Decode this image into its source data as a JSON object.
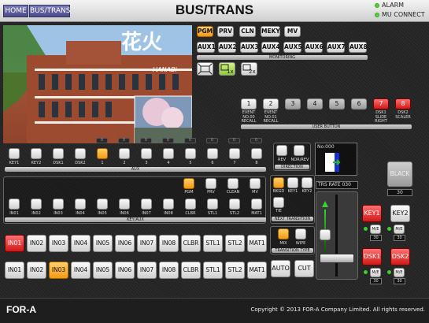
{
  "header": {
    "home_label": "HOME",
    "crumb_label": "BUS/TRANS",
    "title": "BUS/TRANS",
    "alarm": "ALARM",
    "mu_connect": "MU CONNECT"
  },
  "photo_caption": "HANABI",
  "monitoring": {
    "row1": [
      "PGM",
      "PRV",
      "CLN",
      "MEKY",
      "MV"
    ],
    "row2": [
      "AUX1",
      "AUX2",
      "AUX3",
      "AUX4",
      "AUX5",
      "AUX6",
      "AUX7",
      "AUX8"
    ],
    "label": "MONITORING"
  },
  "user_button": {
    "buttons": [
      "1",
      "2",
      "3",
      "4",
      "5",
      "6",
      "7",
      "8"
    ],
    "sublabels": [
      "EVENT\nNO.00\nRECALL",
      "EVENT\nNO.01\nRECALL",
      "",
      "",
      "",
      "",
      "DSK1\nSLIDE\nRIGHT",
      "DSK2\nSCALER"
    ],
    "label": "USER BUTTON"
  },
  "aux": {
    "nums": [
      "0",
      "0",
      "0",
      "0",
      "0",
      "0",
      "0",
      "0"
    ],
    "labels": [
      "KEY1",
      "KEY2",
      "DSK1",
      "DSK2",
      "1",
      "2",
      "3",
      "4",
      "5",
      "6",
      "7",
      "8"
    ],
    "label": "AUX"
  },
  "direction": {
    "buttons": [
      "REV",
      "NOR/REV"
    ],
    "label": "DIRECTION"
  },
  "keyaux": {
    "top": [
      "PGM",
      "PRV",
      "CLEAN",
      "MV"
    ],
    "bottom": [
      "IN01",
      "IN02",
      "IN03",
      "IN04",
      "IN05",
      "IN06",
      "IN07",
      "IN08",
      "CLBR",
      "STL1",
      "STL2",
      "MAT1"
    ],
    "label": "KEY/AUX"
  },
  "monitor_no": "No:000",
  "black": {
    "label": "BLACK",
    "value": "30"
  },
  "next_transition": {
    "buttons": [
      "BKGD",
      "KEY1",
      "KEY2",
      "TIE"
    ],
    "label": "NEXT TRANSITION"
  },
  "trs_rate": "TRS RATE  030",
  "transition_type": {
    "buttons": [
      "MIX",
      "WIPE"
    ],
    "label": "TRANSITION TYPE"
  },
  "key1": {
    "label": "KEY1",
    "me": "M/E",
    "value": "30"
  },
  "key2": {
    "label": "KEY2",
    "me": "M/E",
    "value": "30"
  },
  "dsk1": {
    "label": "DSK1",
    "me": "M/E",
    "value": "30"
  },
  "dsk2": {
    "label": "DSK2",
    "me": "M/E",
    "value": "30"
  },
  "pgm_row": [
    "IN01",
    "IN02",
    "IN03",
    "IN04",
    "IN05",
    "IN06",
    "IN07",
    "IN08",
    "CLBR",
    "STL1",
    "STL2",
    "MAT1"
  ],
  "pst_row": [
    "IN01",
    "IN02",
    "IN03",
    "IN04",
    "IN05",
    "IN06",
    "IN07",
    "IN08",
    "CLBR",
    "STL1",
    "STL2",
    "MAT1"
  ],
  "auto": "AUTO",
  "cut": "CUT",
  "footer": {
    "logo": "FOR-A",
    "copyright": "Copyright © 2013 FOR-A Company Limited. All rights reserved."
  },
  "colors": {
    "active_orange": "#f29a15",
    "active_red": "#d01818",
    "nav_blue": "#4b4b8a"
  }
}
